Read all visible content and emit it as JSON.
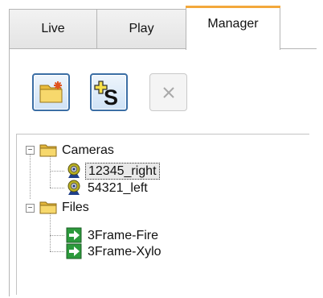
{
  "tabs": [
    {
      "label": "Live"
    },
    {
      "label": "Play"
    },
    {
      "label": "Manager"
    }
  ],
  "toolbar": {
    "buttons": [
      {
        "icon": "new-folder-icon",
        "enabled": true
      },
      {
        "icon": "add-source-icon",
        "text": "S",
        "enabled": true
      },
      {
        "icon": "close-icon",
        "enabled": false
      }
    ]
  },
  "tree": {
    "groups": [
      {
        "label": "Cameras",
        "expander": "−",
        "icon": "folder-icon",
        "children": [
          {
            "label": "12345_right",
            "icon": "camera-icon",
            "selected": true
          },
          {
            "label": "54321_left",
            "icon": "camera-icon",
            "selected": false
          }
        ]
      },
      {
        "label": "Files",
        "expander": "−",
        "icon": "folder-icon",
        "children": [
          {
            "label": "3Frame-Fire",
            "icon": "video-file-icon",
            "selected": false
          },
          {
            "label": "3Frame-Xylo",
            "icon": "video-file-icon",
            "selected": false
          }
        ]
      }
    ]
  },
  "colors": {
    "active_tab_accent": "#f3a83b",
    "button_border": "#3b6ea5",
    "folder": "#f5d56b"
  }
}
